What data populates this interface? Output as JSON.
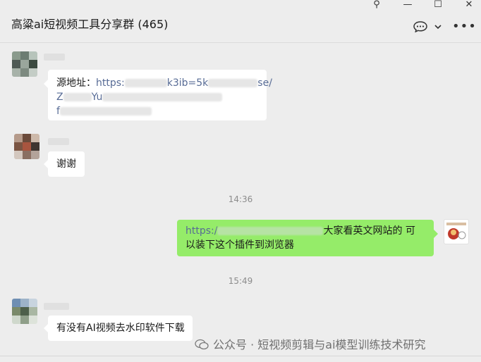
{
  "window": {
    "title": "高粱ai短视频工具分享群 (465)",
    "controls": {
      "pin": "⚲",
      "minimize": "—",
      "maximize": "☐",
      "close": "✕"
    },
    "more": "•••"
  },
  "header_icons": [
    "chat-bubble-icon",
    "chevron-down-icon",
    "more-icon"
  ],
  "messages": [
    {
      "side": "left",
      "text_prefix": "源地址：",
      "link_start": "https:",
      "link_mid": "k3ib=5k",
      "link_end": "se/",
      "line2_start": "Z",
      "line2_mid": "Yu",
      "line3_start": "f"
    },
    {
      "side": "left",
      "text": "谢谢"
    },
    {
      "time": "14:36"
    },
    {
      "side": "right",
      "link_start": "https:/",
      "text_after": "大家看英文网站的 可以装下这个插件到浏览器",
      "line1_tail": "大家看英文网站的 可",
      "line2": "以装下这个插件到浏览器"
    },
    {
      "time": "15:49"
    },
    {
      "side": "left",
      "text": "有没有AI视频去水印软件下载"
    }
  ],
  "watermark": {
    "text": "公众号 · 短视频剪辑与ai模型训练技术研究"
  },
  "colors": {
    "bg": "#ededed",
    "bubble_left": "#ffffff",
    "bubble_right": "#95ec69",
    "link": "#576b95",
    "time": "#8c8c8c"
  }
}
